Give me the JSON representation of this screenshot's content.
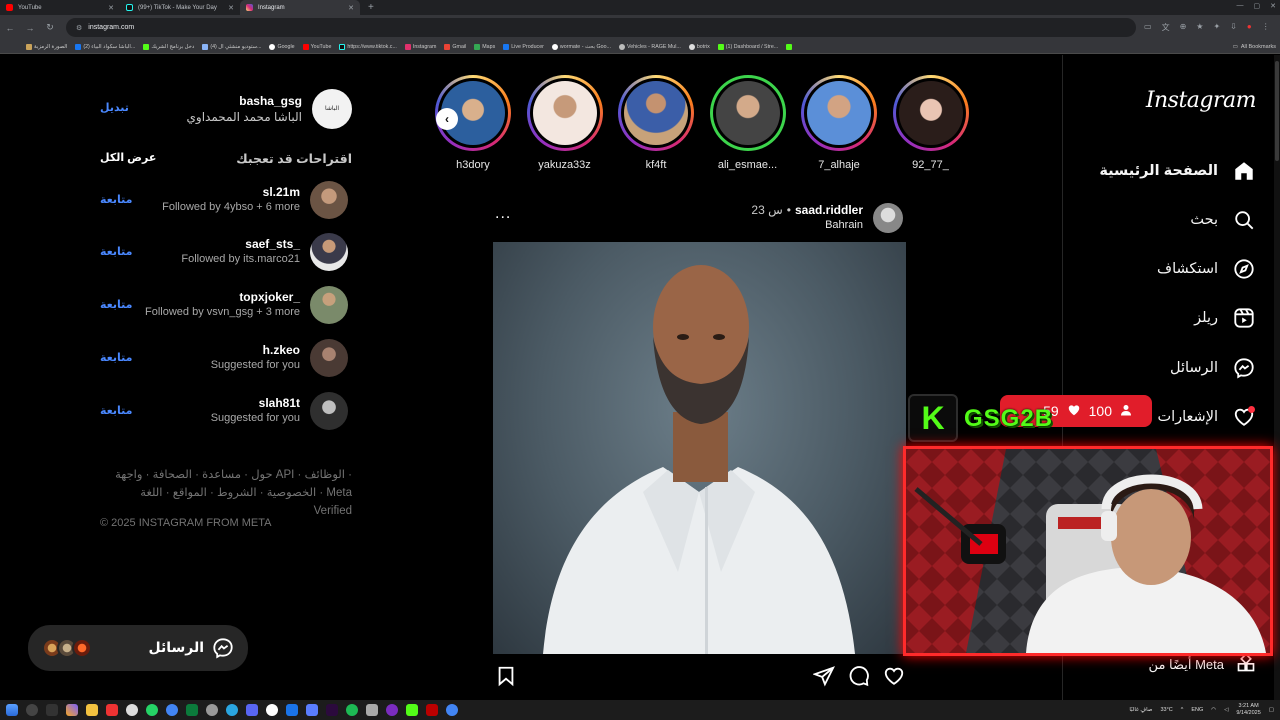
{
  "browser": {
    "tabs": [
      {
        "title": "YouTube",
        "color": "#ff0000",
        "active": false
      },
      {
        "title": "(99+) TikTok - Make Your Day",
        "color": "#111111",
        "active": false
      },
      {
        "title": "Instagram",
        "color": "#e1306c",
        "active": true
      }
    ],
    "url": "instagram.com",
    "bookmarks": [
      "الصورة الرمزية",
      "(2) الباشا سكواد البياء...",
      "دخل برنامج الشريك",
      "(4) ستوديو منشئي ال...",
      "Google",
      "YouTube",
      "https://www.tiktok.c...",
      "Instagram",
      "Gmail",
      "Maps",
      "Live Producer",
      "wormate - بحث Goo...",
      "Vehicles - RAGE Mul...",
      "botrix",
      "(1) Dashboard / Stre..."
    ],
    "all_bookmarks": "All Bookmarks"
  },
  "sidenav": {
    "logo": "Instagram",
    "items": [
      {
        "label": "الصفحة الرئيسية",
        "icon": "home-icon"
      },
      {
        "label": "بحث",
        "icon": "search-icon"
      },
      {
        "label": "استكشاف",
        "icon": "explore-icon"
      },
      {
        "label": "ريلز",
        "icon": "reels-icon"
      },
      {
        "label": "الرسائل",
        "icon": "messenger-icon"
      },
      {
        "label": "الإشعارات",
        "icon": "heart-icon"
      }
    ],
    "also_from_meta": "أيضًا من Meta"
  },
  "stories": [
    {
      "name": "h3dory",
      "ring": "gradient"
    },
    {
      "name": "yakuza33z",
      "ring": "gradient"
    },
    {
      "name": "kf4ft",
      "ring": "gradient"
    },
    {
      "name": "ali_esmae...",
      "ring": "green"
    },
    {
      "name": "7_alhaje",
      "ring": "gradient"
    },
    {
      "name": "92_77_",
      "ring": "gradient"
    }
  ],
  "post": {
    "username": "saad.riddler",
    "time": "23 س",
    "separator": "•",
    "location": "Bahrain",
    "more": "..."
  },
  "profile": {
    "username": "basha_gsg",
    "full_name": "الباشا محمد المحمداوي",
    "switch_label": "تبديل",
    "avatar_text": "الباشا"
  },
  "suggestions": {
    "title": "اقتراحات قد تعجبك",
    "see_all": "عرض الكل",
    "follow_label": "متابعة",
    "items": [
      {
        "username": "sl.21m",
        "subtitle": "Followed by 4ybso + 6 more"
      },
      {
        "username": "saef_sts_",
        "subtitle": "Followed by its.marco21"
      },
      {
        "username": "topxjoker_",
        "subtitle": "Followed by vsvn_gsg + 3 more"
      },
      {
        "username": "h.zkeo",
        "subtitle": "Suggested for you"
      },
      {
        "username": "slah81t",
        "subtitle": "Suggested for you"
      }
    ]
  },
  "footer": {
    "line1": "حول · مساعدة · الصحافة · واجهة API · الوظائف ·",
    "line2": "الخصوصية · الشروط · المواقع · اللغة · Meta Verified",
    "copyright": "© 2025 INSTAGRAM FROM META"
  },
  "messages_bar": {
    "label": "الرسائل"
  },
  "overlay": {
    "k_letter": "K",
    "channel": "GSG2B",
    "viewers": "100",
    "likes": "59"
  },
  "taskbar": {
    "weather": "33°C",
    "weather_text": "صافٍ غالبًا",
    "lang": "ENG",
    "time": "3:21 AM",
    "date": "9/14/2025"
  },
  "colors": {
    "accent_blue": "#4a88ff",
    "kick_green": "#53fc18",
    "live_red": "#e11d2a"
  }
}
